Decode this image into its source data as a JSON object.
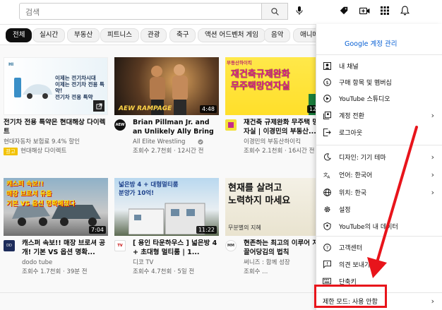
{
  "search": {
    "placeholder": "검색"
  },
  "chips": [
    "전체",
    "실시간",
    "부동산",
    "피트니스",
    "관광",
    "축구",
    "액션 어드벤처 게임",
    "음악",
    "애니메"
  ],
  "videos": [
    {
      "title": "전기차 전용 특약은 현대해상 다이렉트",
      "meta1": "현대자동차 보험료 9.4% 할인",
      "meta2": "현대해상 다이렉트",
      "badge": "광고",
      "thumb_text": "이제는 전기차시대\n이제는 전기차 전용 특약!\n전기차 전용 특약",
      "duration": ""
    },
    {
      "title": "Brian Pillman Jr. and an Unlikely Ally Bring the...",
      "meta1": "All Elite Wrestling",
      "meta2": "조회수 2.7천회 · 12시간 전",
      "thumb_text": "AEW RAMPAGE",
      "duration": "4:48"
    },
    {
      "title": "재건축 규제완화 무주택 망연자실 | 이경민의 부동산...",
      "meta1": "이경민의 부동산하이킥",
      "meta2": "조회수 2.1천회 · 16시간 전",
      "thumb_text": "재건축규제완화\n무주택망연자실",
      "thumb_tag": "부동산하이킥",
      "duration": "12:56"
    },
    {
      "title": "캐스퍼 속보!! 매장 브로셔 공개! 기본 VS 옵션 명확...",
      "meta1": "dodo tube",
      "meta2": "조회수 1.7천회 · 39분 전",
      "thumb_text": "캐스퍼 속보!!\n매장 브로셔 유출\n기본 VS 옵션 명확해졌다",
      "duration": "7:04"
    },
    {
      "title": "[ 용인 타운하우스 ] 넓은방 4 + 초대형 멀티룸 | 1...",
      "meta1": "디코 TV",
      "meta2": "조회수 4.7천회 · 5일 전",
      "thumb_text": "넓은방 4 + 대형멀티룸\n분양가 10억!",
      "duration": "11:22"
    },
    {
      "title": "현존하는 최고의 이루어 지는 끌어당김의 법칙",
      "meta1": "써니즈 : 함께 성장",
      "meta2": "조회수 ...",
      "thumb_text": "현재를 살려고\n노력하지 마세요",
      "thumb_tag": "무분별의 지혜",
      "duration": ""
    }
  ],
  "menu": {
    "google_account": "Google 계정 관리",
    "items": [
      {
        "label": "내 채널",
        "icon": "person-icon",
        "chevron": false
      },
      {
        "label": "구매 항목 및 멤버십",
        "icon": "dollar-icon",
        "chevron": false
      },
      {
        "label": "YouTube 스튜디오",
        "icon": "studio-icon",
        "chevron": false
      },
      {
        "label": "계정 전환",
        "icon": "switch-account-icon",
        "chevron": true
      },
      {
        "label": "로그아웃",
        "icon": "logout-icon",
        "chevron": false
      },
      {
        "label": "디자인: 기기 테마",
        "icon": "moon-icon",
        "chevron": true
      },
      {
        "label": "언어: 한국어",
        "icon": "translate-icon",
        "chevron": true
      },
      {
        "label": "위치: 한국",
        "icon": "globe-icon",
        "chevron": true
      },
      {
        "label": "설정",
        "icon": "gear-icon",
        "chevron": false
      },
      {
        "label": "YouTube의 내 데이터",
        "icon": "shield-icon",
        "chevron": false
      },
      {
        "label": "고객센터",
        "icon": "help-icon",
        "chevron": false
      },
      {
        "label": "의견 보내기",
        "icon": "feedback-icon",
        "chevron": false
      },
      {
        "label": "단축키",
        "icon": "keyboard-icon",
        "chevron": false
      }
    ],
    "restricted_mode": "제한 모드: 사용 안함"
  },
  "colors": {
    "highlight": "#e8141b",
    "link": "#065fd4",
    "ad_badge": "#f2c200"
  }
}
